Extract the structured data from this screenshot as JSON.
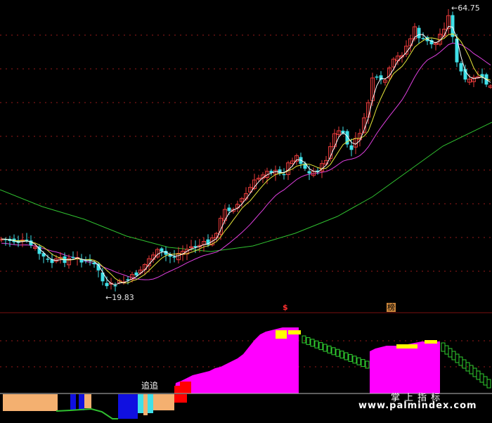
{
  "annotations": {
    "high_label": "64.75",
    "low_label": "19.83",
    "signal_s": "$",
    "signal_bang": "榜",
    "chase_label": "追追"
  },
  "watermark": {
    "line1": "掌上指标",
    "line2": "www.palmindex.com"
  },
  "colors": {
    "background": "#000000",
    "bull_candle": "#e83a3a",
    "bear_candle": "#40e0e8",
    "ma_short": "#ffffff",
    "ma_mid": "#e8e83a",
    "ma_long": "#e040e0",
    "ma_slow": "#30c030",
    "oscillator": "#ff00ff",
    "oscillator_top": "#ffff00",
    "oscillator_down": "#30d030",
    "volume_up": "#f4b070",
    "volume_blue": "#1010e0",
    "volume_cyan": "#40e0e8",
    "volume_red": "#ff0000"
  },
  "chart_data": {
    "type": "candlestick",
    "y_range": [
      19.83,
      64.75
    ],
    "price_high": 64.75,
    "price_low": 19.83,
    "grid": true,
    "series": [
      {
        "name": "",
        "kind": "candles",
        "count": 118
      },
      {
        "name": "",
        "kind": "moving-average"
      },
      {
        "name": "",
        "kind": "moving-average"
      },
      {
        "name": "",
        "kind": "moving-average"
      },
      {
        "name": "",
        "kind": "moving-average"
      }
    ],
    "oscillator": {
      "type": "area"
    },
    "volume": {
      "type": "bar"
    }
  }
}
